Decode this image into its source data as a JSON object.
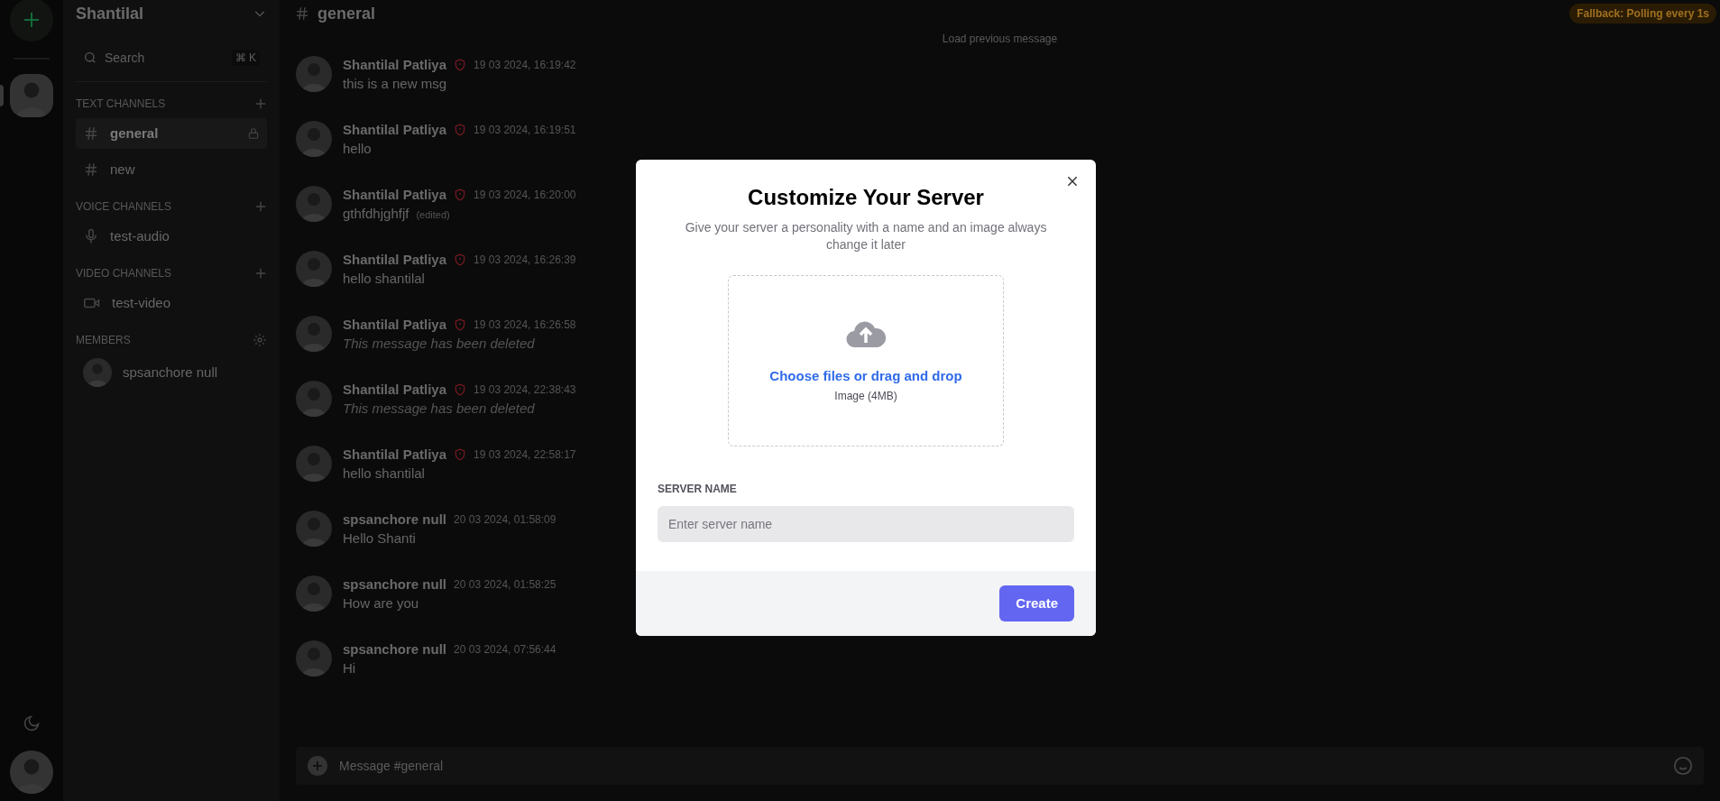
{
  "server": {
    "name": "Shantilal"
  },
  "search": {
    "placeholder": "Search",
    "shortcut_symbol": "⌘",
    "shortcut_key": "K"
  },
  "sections": [
    {
      "title": "TEXT CHANNELS",
      "kind": "channels",
      "items": [
        {
          "name": "general",
          "kind": "text",
          "selected": true,
          "locked": true
        },
        {
          "name": "new",
          "kind": "text",
          "selected": false,
          "locked": false
        }
      ]
    },
    {
      "title": "VOICE CHANNELS",
      "kind": "channels",
      "items": [
        {
          "name": "test-audio",
          "kind": "audio",
          "selected": false,
          "locked": false
        }
      ]
    },
    {
      "title": "VIDEO CHANNELS",
      "kind": "channels",
      "items": [
        {
          "name": "test-video",
          "kind": "video",
          "selected": false,
          "locked": false
        }
      ]
    },
    {
      "title": "MEMBERS",
      "kind": "members",
      "items": [
        {
          "name": "spsanchore null",
          "kind": "member",
          "selected": false,
          "locked": false
        }
      ]
    }
  ],
  "channel_header": {
    "title": "general"
  },
  "status_badge": "Fallback: Polling every 1s",
  "load_previous": "Load previous message",
  "messages": [
    {
      "author": "Shantilal Patliya",
      "admin": true,
      "time": "19 03 2024, 16:19:42",
      "text": "this is a new msg",
      "deleted": false
    },
    {
      "author": "Shantilal Patliya",
      "admin": true,
      "time": "19 03 2024, 16:19:51",
      "text": "hello",
      "deleted": false
    },
    {
      "author": "Shantilal Patliya",
      "admin": true,
      "time": "19 03 2024, 16:20:00",
      "text": "gthfdhjghfjf",
      "edited": "(edited)",
      "deleted": false
    },
    {
      "author": "Shantilal Patliya",
      "admin": true,
      "time": "19 03 2024, 16:26:39",
      "text": "hello shantilal",
      "deleted": false
    },
    {
      "author": "Shantilal Patliya",
      "admin": true,
      "time": "19 03 2024, 16:26:58",
      "text": "This message has been deleted",
      "deleted": true
    },
    {
      "author": "Shantilal Patliya",
      "admin": true,
      "time": "19 03 2024, 22:38:43",
      "text": "This message has been deleted",
      "deleted": true
    },
    {
      "author": "Shantilal Patliya",
      "admin": true,
      "time": "19 03 2024, 22:58:17",
      "text": "hello shantilal",
      "deleted": false
    },
    {
      "author": "spsanchore null",
      "admin": false,
      "time": "20 03 2024, 01:58:09",
      "text": "Hello Shanti",
      "deleted": false
    },
    {
      "author": "spsanchore null",
      "admin": false,
      "time": "20 03 2024, 01:58:25",
      "text": "How are you",
      "deleted": false
    },
    {
      "author": "spsanchore null",
      "admin": false,
      "time": "20 03 2024, 07:56:44",
      "text": "Hi",
      "deleted": false
    }
  ],
  "composer": {
    "placeholder": "Message #general"
  },
  "modal": {
    "title": "Customize Your Server",
    "subtitle": "Give your server a personality with a name and an image always change it later",
    "upload_link": "Choose files or drag and drop",
    "upload_hint": "Image (4MB)",
    "field_label": "SERVER NAME",
    "field_placeholder": "Enter server name",
    "button": "Create"
  }
}
